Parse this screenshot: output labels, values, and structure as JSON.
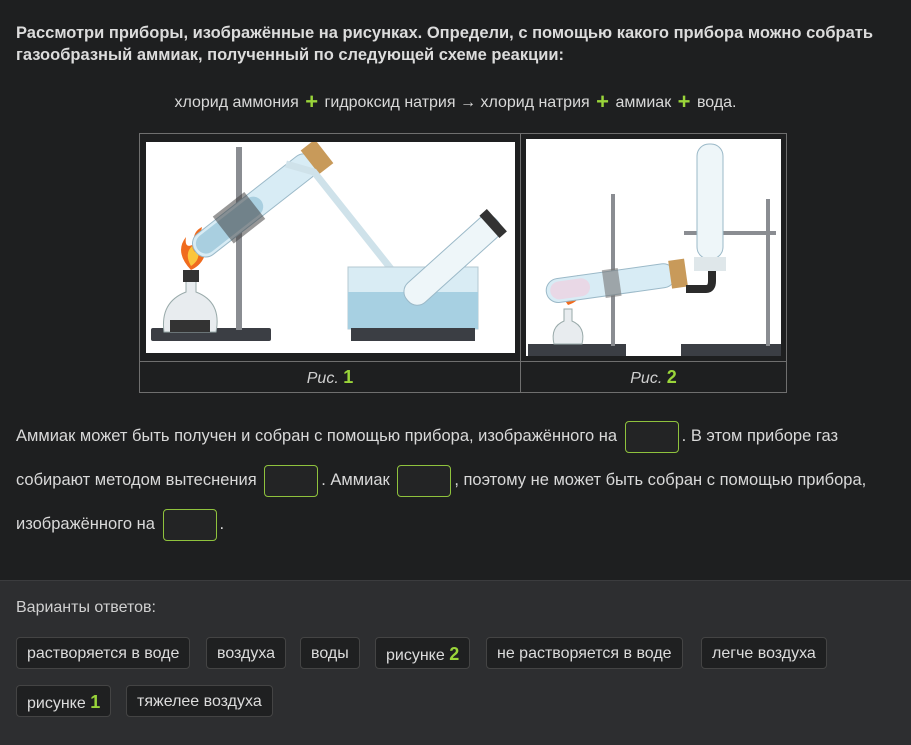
{
  "question": "Рассмотри приборы, изображённые на рисунках. Определи, с помощью какого прибора можно собрать газообразный аммиак, полученный по следующей схеме реакции:",
  "equation": {
    "part1": "хлорид аммония",
    "part2": "гидроксид натрия",
    "arrow": "→",
    "part3": "хлорид натрия",
    "part4": "аммиак",
    "part5": "вода.",
    "plus": "+"
  },
  "figures": [
    {
      "caption_prefix": "Рис.",
      "caption_num": "1",
      "icon": "apparatus-water-displacement"
    },
    {
      "caption_prefix": "Рис.",
      "caption_num": "2",
      "icon": "apparatus-inverted-tube"
    }
  ],
  "fill": {
    "s1": "Аммиак может быть получен и собран с помощью прибора, изображённого на",
    "s2": ". В этом приборе газ собирают методом вытеснения",
    "s3": ". Аммиак",
    "s4": ", поэтому не может быть собран с помощью прибора, изображённого на",
    "s5": "."
  },
  "answers": {
    "title": "Варианты ответов:",
    "options": [
      {
        "text": "растворяется в воде",
        "num": ""
      },
      {
        "text": "воздуха",
        "num": ""
      },
      {
        "text": "воды",
        "num": ""
      },
      {
        "text": "рисунке",
        "num": "2"
      },
      {
        "text": "не растворяется в воде",
        "num": ""
      },
      {
        "text": "легче воздуха",
        "num": ""
      },
      {
        "text": "рисунке",
        "num": "1"
      },
      {
        "text": "тяжелее воздуха",
        "num": ""
      }
    ]
  },
  "colors": {
    "accent": "#9ad53a",
    "background": "#1e1f20",
    "panel": "#2d2e30"
  }
}
